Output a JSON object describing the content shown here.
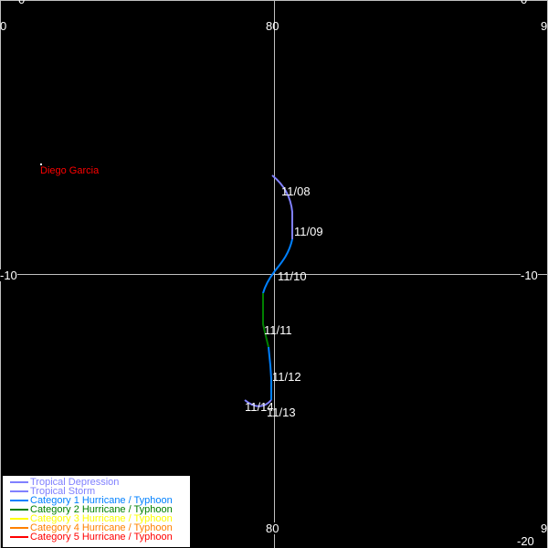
{
  "grid": {
    "lon_labels_top": [
      "0",
      "80",
      "9"
    ],
    "lon_labels_bottom": [
      "80",
      "9"
    ],
    "lat_labels_top": [
      "0",
      "0"
    ],
    "lat_labels_mid": [
      "-10",
      "-10"
    ],
    "lat_label_bottom_right": "-20"
  },
  "places": [
    {
      "name": "Diego Garcia"
    }
  ],
  "track_dates": [
    "11/08",
    "11/09",
    "11/10",
    "11/11",
    "11/12",
    "11/13",
    "11/14"
  ],
  "legend": [
    {
      "label": "Tropical Depression",
      "color": "#8080ff"
    },
    {
      "label": "Tropical Storm",
      "color": "#8080ff"
    },
    {
      "label": "Category 1 Hurricane / Typhoon",
      "color": "#0080ff"
    },
    {
      "label": "Category 2 Hurricane / Typhoon",
      "color": "#008000"
    },
    {
      "label": "Category 3 Hurricane / Typhoon",
      "color": "#ffff00"
    },
    {
      "label": "Category 4 Hurricane / Typhoon",
      "color": "#ff8000"
    },
    {
      "label": "Category 5 Hurricane / Typhoon",
      "color": "#ff0000"
    }
  ]
}
